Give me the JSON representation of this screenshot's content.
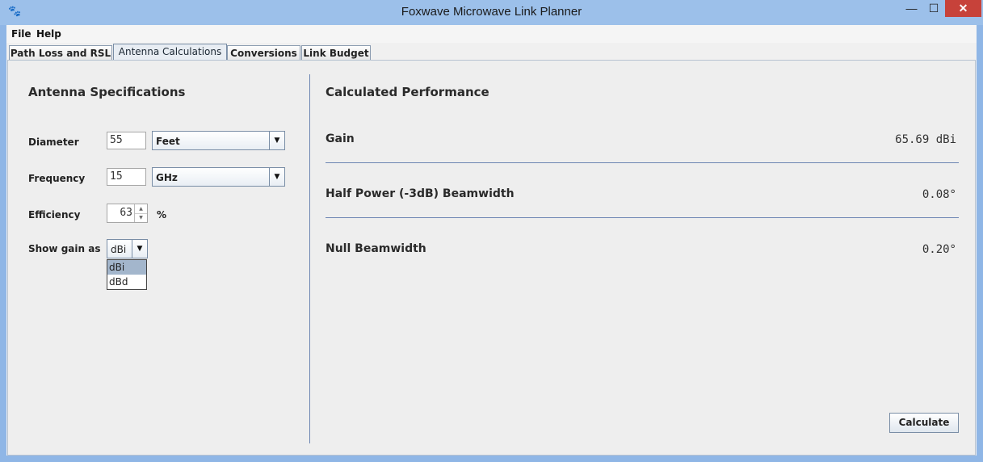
{
  "window": {
    "title": "Foxwave Microwave Link Planner",
    "icon": "paw-icon",
    "controls": {
      "minimize": "—",
      "maximize": "☐",
      "close": "✕"
    }
  },
  "menu": {
    "file": "File",
    "help": "Help"
  },
  "tabs": [
    {
      "label": "Path Loss and RSL",
      "active": false
    },
    {
      "label": "Antenna Calculations",
      "active": true
    },
    {
      "label": "Conversions",
      "active": false
    },
    {
      "label": "Link Budget",
      "active": false
    }
  ],
  "specs": {
    "title": "Antenna Specifications",
    "diameter": {
      "label": "Diameter",
      "value": "55",
      "unit": "Feet"
    },
    "frequency": {
      "label": "Frequency",
      "value": "15",
      "unit": "GHz"
    },
    "efficiency": {
      "label": "Efficiency",
      "value": "63",
      "unit": "%"
    },
    "gain_as": {
      "label": "Show gain as",
      "value": "dBi",
      "options": [
        "dBi",
        "dBd"
      ]
    }
  },
  "performance": {
    "title": "Calculated Performance",
    "gain": {
      "label": "Gain",
      "value": "65.69 dBi"
    },
    "half_power": {
      "label": "Half Power (-3dB) Beamwidth",
      "value": "0.08°"
    },
    "null": {
      "label": "Null Beamwidth",
      "value": "0.20°"
    }
  },
  "actions": {
    "calculate": "Calculate"
  }
}
